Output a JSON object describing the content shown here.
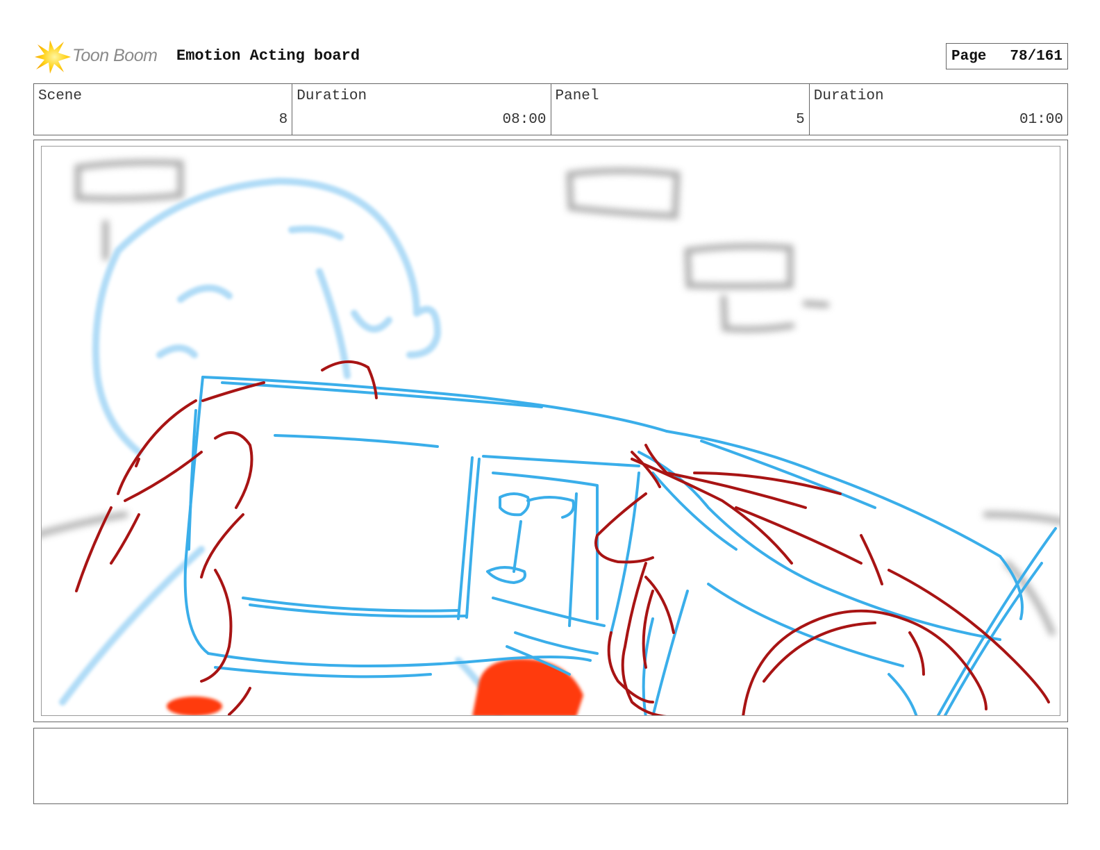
{
  "header": {
    "logo_text": "Toon Boom",
    "board_title": "Emotion Acting board",
    "page_label": "Page",
    "page_number": "78/161"
  },
  "info": [
    {
      "label": "Scene",
      "value": "8"
    },
    {
      "label": "Duration",
      "value": "08:00"
    },
    {
      "label": "Panel",
      "value": "5"
    },
    {
      "label": "Duration",
      "value": "01:00"
    }
  ],
  "panel": {
    "sketch_colors": {
      "blue": "#3aaeea",
      "red": "#a81414",
      "orange": "#ff3a0a",
      "grey": "#9a9a9a"
    }
  },
  "notes": {
    "text": ""
  }
}
